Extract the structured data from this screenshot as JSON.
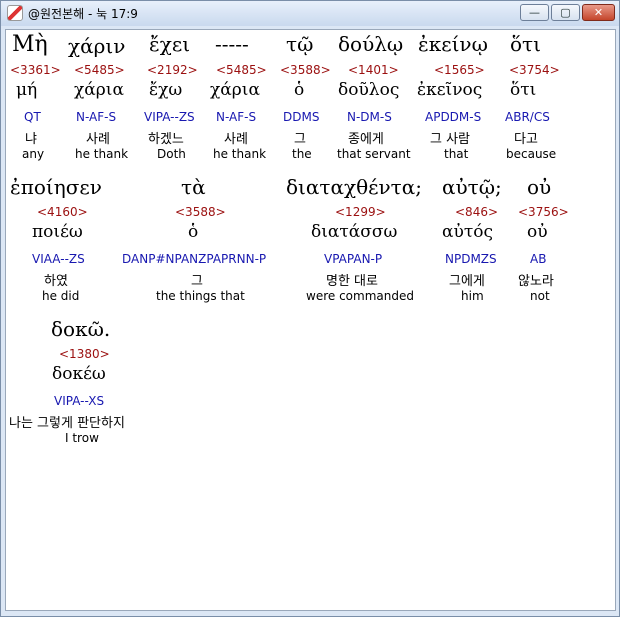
{
  "window": {
    "title": "@원전본해 - 눅 17:9",
    "controls": {
      "minimize": "—",
      "maximize": "▢",
      "close": "✕"
    }
  },
  "rows": [
    [
      {
        "greek": "Μὴ",
        "strong": "<3361>",
        "lemma": "μή",
        "parse": "QT",
        "korean": "냐",
        "english": "any"
      },
      {
        "greek": "χάριν",
        "strong": "<5485>",
        "lemma": "χάρια",
        "parse": "N-AF-S",
        "korean": "사례",
        "english": "he thank"
      },
      {
        "greek": "ἔχει",
        "strong": "<2192>",
        "lemma": "ἔχω",
        "parse": "VIPA--ZS",
        "korean": "하겠느",
        "english": "Doth"
      },
      {
        "greek": "-----",
        "strong": "<5485>",
        "lemma": "χάρια",
        "parse": "N-AF-S",
        "korean": "사례",
        "english": "he thank"
      },
      {
        "greek": "τῷ",
        "strong": "<3588>",
        "lemma": "ὁ",
        "parse": "DDMS",
        "korean": "그",
        "english": "the"
      },
      {
        "greek": "δούλῳ",
        "strong": "<1401>",
        "lemma": "δοῦλος",
        "parse": "N-DM-S",
        "korean": "종에게",
        "english": "that servant"
      },
      {
        "greek": "ἐκείνῳ",
        "strong": "<1565>",
        "lemma": "ἐκεῖνος",
        "parse": "APDDM-S",
        "korean": "그 사람",
        "english": "that"
      },
      {
        "greek": "ὅτι",
        "strong": "<3754>",
        "lemma": "ὅτι",
        "parse": "ABR/CS",
        "korean": "다고",
        "english": "because"
      }
    ],
    [
      {
        "greek": "ἐποίησεν",
        "strong": "<4160>",
        "lemma": "ποιέω",
        "parse": "VIAA--ZS",
        "korean": "하였",
        "english": "he did"
      },
      {
        "greek": "τὰ",
        "strong": "<3588>",
        "lemma": "ὁ",
        "parse": "DANP#NPANZPAPRNN-P",
        "korean": "그",
        "english": "the things that"
      },
      {
        "greek": "διαταχθέντα;",
        "strong": "<1299>",
        "lemma": "διατάσσω",
        "parse": "VPAPAN-P",
        "korean": "명한 대로",
        "english": "were commanded"
      },
      {
        "greek": "αὐτῷ;",
        "strong": "<846>",
        "lemma": "αὐτός",
        "parse": "NPDMZS",
        "korean": "그에게",
        "english": "him"
      },
      {
        "greek": "οὐ",
        "strong": "<3756>",
        "lemma": "οὐ",
        "parse": "AB",
        "korean": "않노라",
        "english": "not"
      }
    ],
    [
      {
        "greek": "δοκῶ.",
        "strong": "<1380>",
        "lemma": "δοκέω",
        "parse": "VIPA--XS",
        "korean": "나는 그렇게 판단하지",
        "english": "I trow"
      }
    ]
  ]
}
